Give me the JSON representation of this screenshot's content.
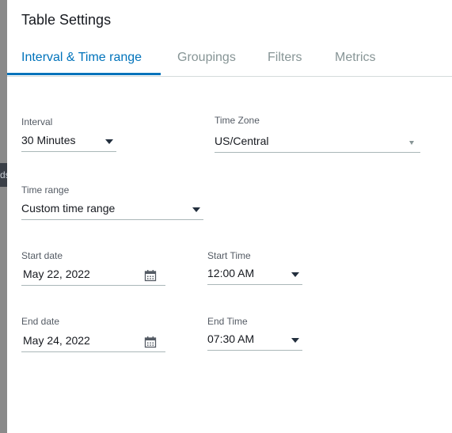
{
  "dialog": {
    "title": "Table Settings"
  },
  "tabs": [
    {
      "label": "Interval & Time range",
      "active": true
    },
    {
      "label": "Groupings",
      "active": false
    },
    {
      "label": "Filters",
      "active": false
    },
    {
      "label": "Metrics",
      "active": false
    }
  ],
  "interval": {
    "label": "Interval",
    "value": "30 Minutes",
    "icon": "caret-down-icon"
  },
  "time_zone": {
    "label": "Time Zone",
    "value": "US/Central",
    "icon": "caret-down-icon"
  },
  "time_range": {
    "label": "Time range",
    "value": "Custom time range",
    "icon": "caret-down-icon"
  },
  "start_date": {
    "label": "Start date",
    "value": "May 22, 2022",
    "icon": "calendar-icon"
  },
  "start_time": {
    "label": "Start Time",
    "value": "12:00 AM",
    "icon": "caret-down-icon"
  },
  "end_date": {
    "label": "End date",
    "value": "May 24, 2022",
    "icon": "calendar-icon"
  },
  "end_time": {
    "label": "End Time",
    "value": "07:30 AM",
    "icon": "caret-down-icon"
  },
  "colors": {
    "accent": "#0073bb",
    "inactive_tab": "#879596",
    "label": "#545b64",
    "text": "#16191f",
    "underline": "#aab7b8"
  }
}
